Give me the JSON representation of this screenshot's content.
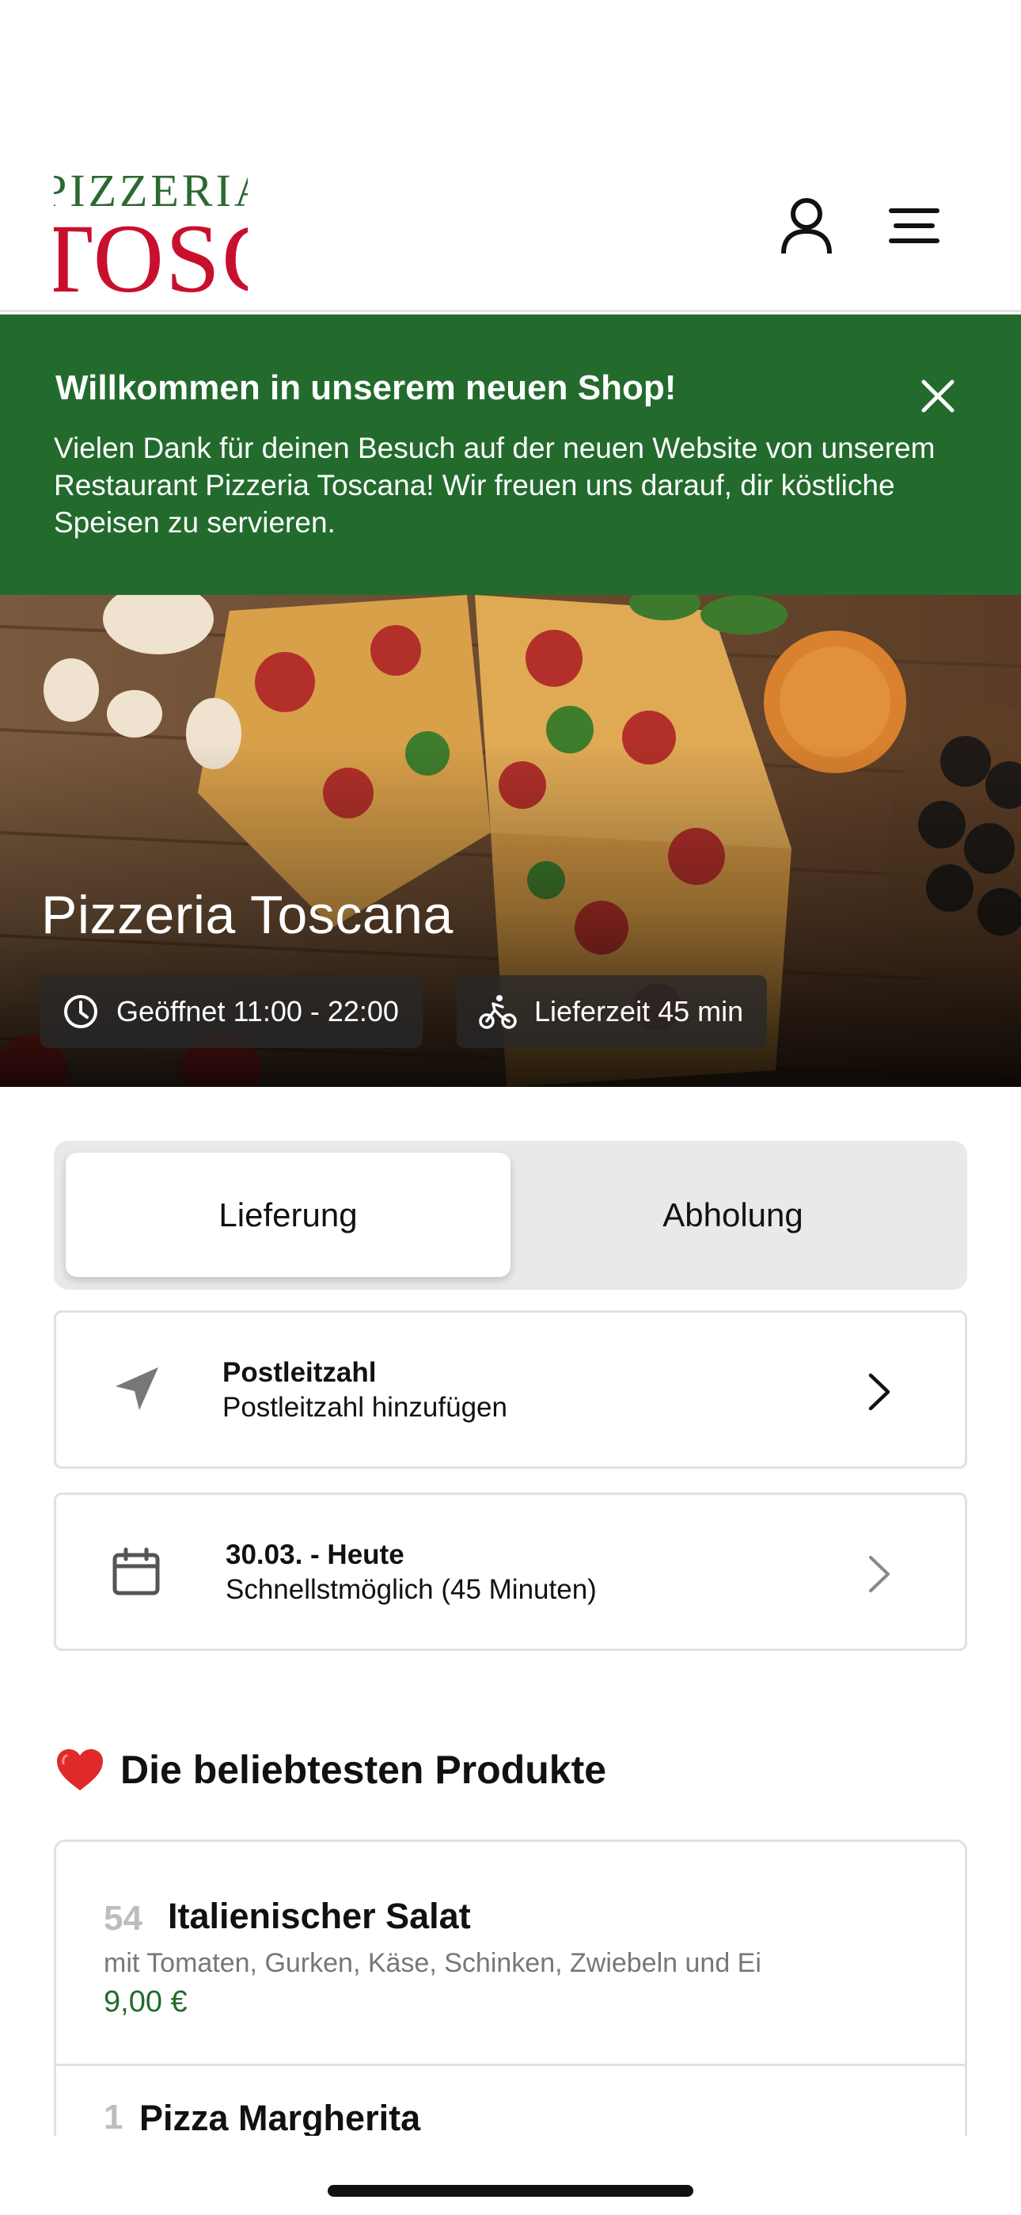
{
  "header": {
    "logo_top": "PIZZERIA",
    "logo_bottom": "TOSCANA",
    "user_icon": "user-icon",
    "menu_icon": "hamburger-menu-icon"
  },
  "banner": {
    "title": "Willkommen in unserem neuen Shop!",
    "text": "Vielen Dank für deinen Besuch auf der neuen Website von unserem Restaurant Pizzeria Toscana! Wir freuen uns darauf, dir köstliche Speisen zu servieren.",
    "close_icon": "close-icon",
    "background": "#226b2d"
  },
  "hero": {
    "title": "Pizzeria Toscana",
    "opening_hours": "Geöffnet 11:00 - 22:00",
    "delivery_time": "Lieferzeit 45 min"
  },
  "order_mode": {
    "options": [
      "Lieferung",
      "Abholung"
    ],
    "selected": "Lieferung"
  },
  "postcode_card": {
    "title": "Postleitzahl",
    "subtitle": "Postleitzahl hinzufügen"
  },
  "date_card": {
    "title": "30.03. - Heute",
    "subtitle": "Schnellstmöglich (45 Minuten)"
  },
  "popular": {
    "heading": "Die beliebtesten Produkte",
    "heading_icon": "❤️",
    "products": [
      {
        "number": "54",
        "name": "Italienischer Salat",
        "description": "mit Tomaten, Gurken, Käse, Schinken, Zwiebeln und Ei",
        "price": "9,00 €"
      },
      {
        "number": "1",
        "name": "Pizza Margherita"
      }
    ]
  },
  "colors": {
    "brand_green": "#226b2d",
    "brand_red": "#c8102e"
  }
}
